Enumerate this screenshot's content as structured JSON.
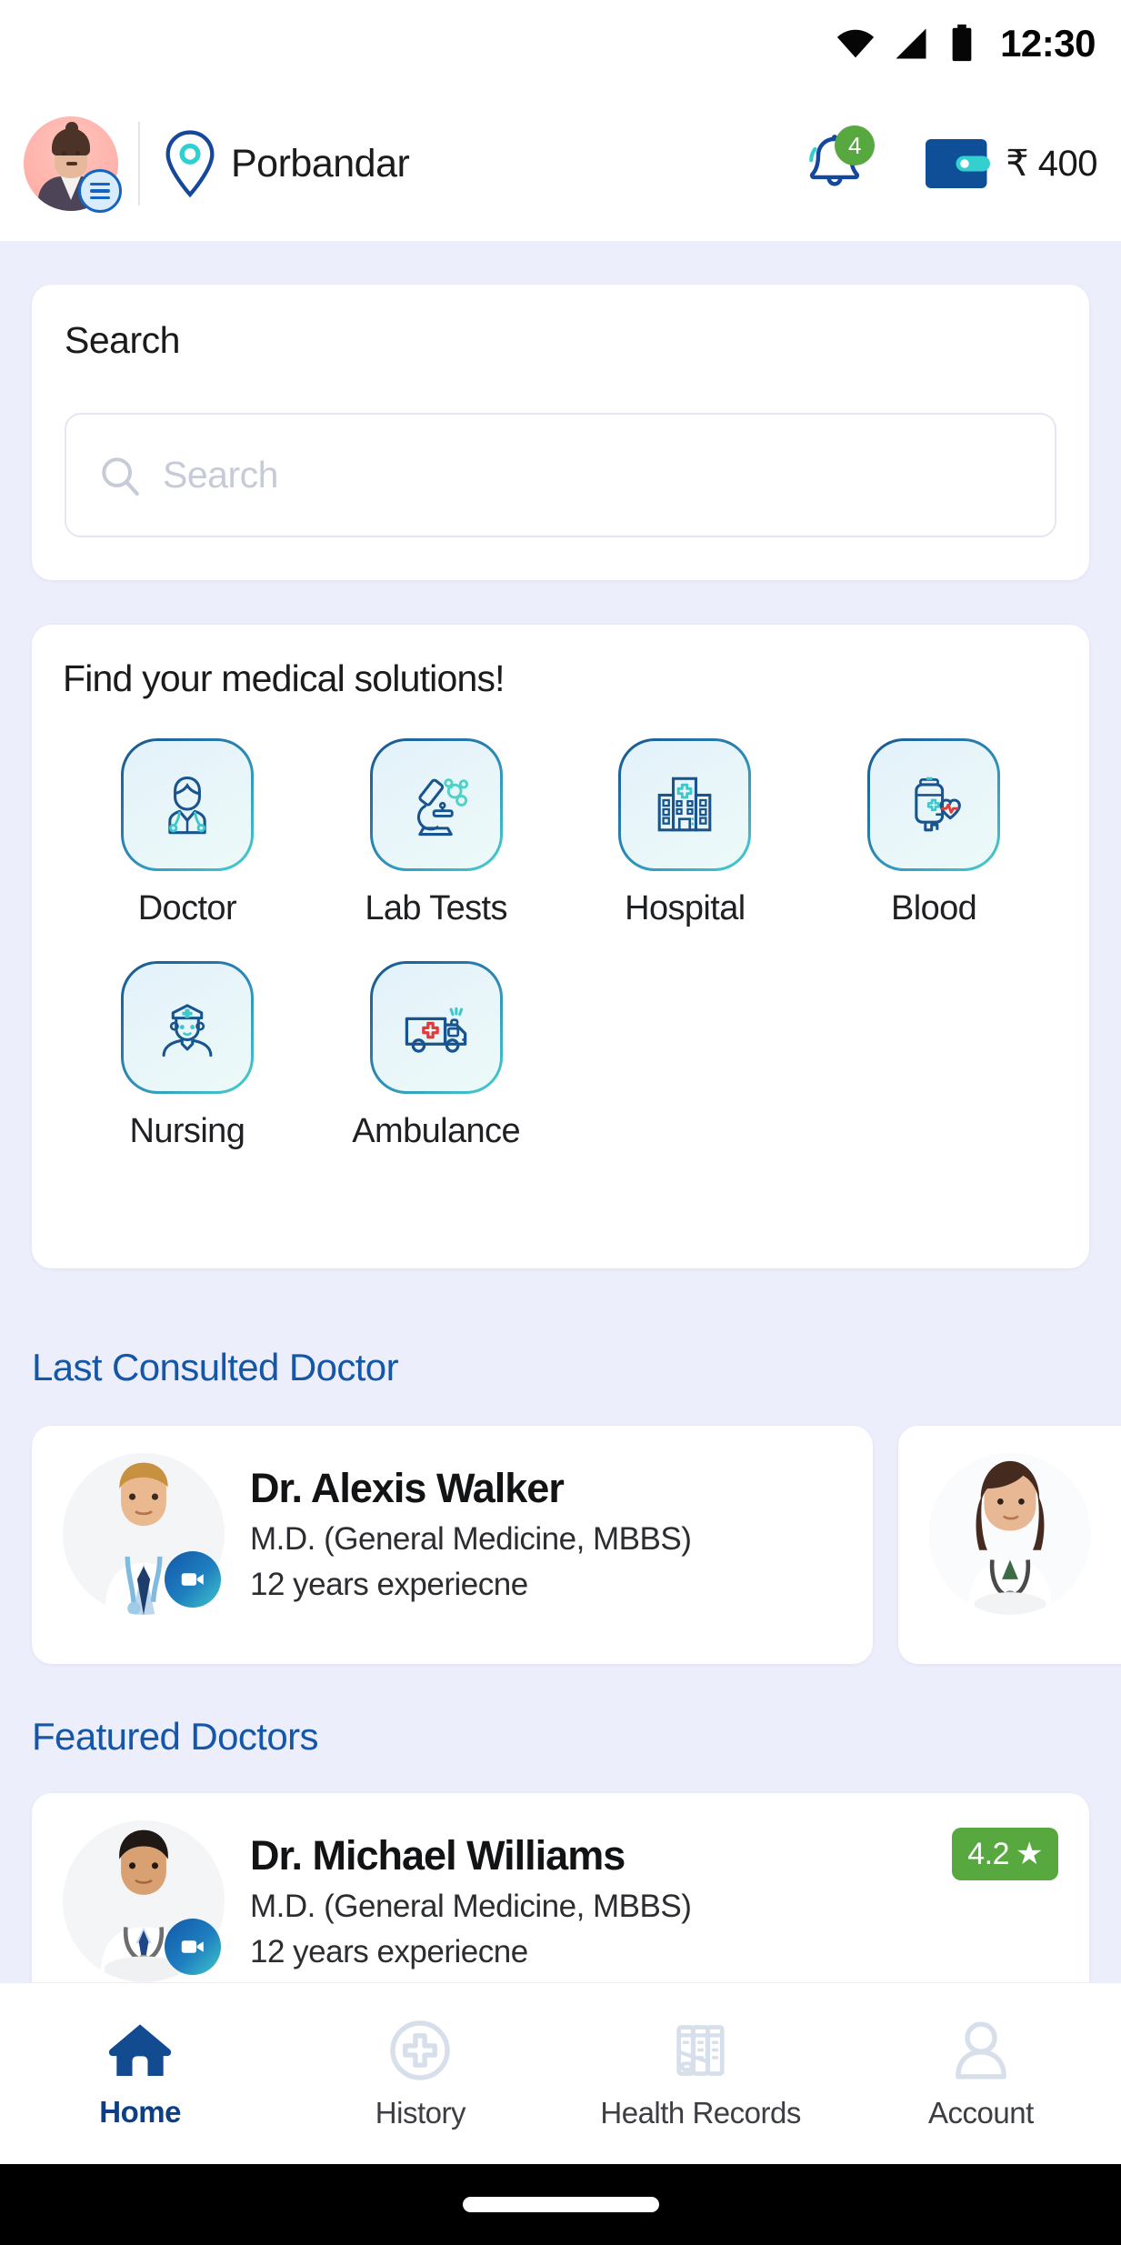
{
  "status_bar": {
    "time": "12:30",
    "icons": [
      "wifi-icon",
      "cellular-signal-icon",
      "battery-icon"
    ]
  },
  "header": {
    "avatar": "user-avatar",
    "menu_badge_icon": "hamburger-menu-icon",
    "location_icon": "location-pin-icon",
    "location": "Porbandar",
    "notification_icon": "bell-icon",
    "notification_count": "4",
    "wallet_icon": "wallet-icon",
    "wallet_amount": "₹ 400"
  },
  "search": {
    "title": "Search",
    "placeholder": "Search",
    "value": "",
    "icon": "search-icon"
  },
  "services": {
    "title": "Find your medical solutions!",
    "items": [
      {
        "label": "Doctor",
        "icon": "doctor-icon"
      },
      {
        "label": "Lab Tests",
        "icon": "microscope-icon"
      },
      {
        "label": "Hospital",
        "icon": "hospital-building-icon"
      },
      {
        "label": "Blood",
        "icon": "blood-bag-heart-icon"
      },
      {
        "label": "Nursing",
        "icon": "nurse-icon"
      },
      {
        "label": "Ambulance",
        "icon": "ambulance-icon"
      }
    ]
  },
  "last_consulted": {
    "title": "Last Consulted Doctor",
    "doctors": [
      {
        "name": "Dr. Alexis Walker",
        "degree": "M.D. (General Medicine, MBBS)",
        "experience": "12 years experiecne",
        "video_badge_icon": "video-call-icon",
        "photo": "male-doctor-photo"
      },
      {
        "name": "",
        "degree": "",
        "experience": "",
        "video_badge_icon": "video-call-icon",
        "photo": "female-doctor-photo"
      }
    ]
  },
  "featured": {
    "title": "Featured Doctors",
    "doctors": [
      {
        "name": "Dr. Michael Williams",
        "degree": "M.D. (General Medicine, MBBS)",
        "experience": "12 years experiecne",
        "rating": "4.2",
        "rating_star": "★",
        "video_badge_icon": "video-call-icon",
        "photo": "male-doctor-photo"
      }
    ]
  },
  "bottom_nav": {
    "items": [
      {
        "label": "Home",
        "icon": "home-icon",
        "active": true
      },
      {
        "label": "History",
        "icon": "medical-cross-circle-icon",
        "active": false
      },
      {
        "label": "Health Records",
        "icon": "records-folders-icon",
        "active": false
      },
      {
        "label": "Account",
        "icon": "person-icon",
        "active": false
      }
    ]
  },
  "colors": {
    "background": "#eceefb",
    "brand_blue": "#1456a8",
    "deep_blue": "#0c3f85",
    "teal": "#3fc8cb",
    "badge_green": "#57a83f",
    "rating_green": "#56a83f",
    "idle_gray": "#d5dce8"
  }
}
